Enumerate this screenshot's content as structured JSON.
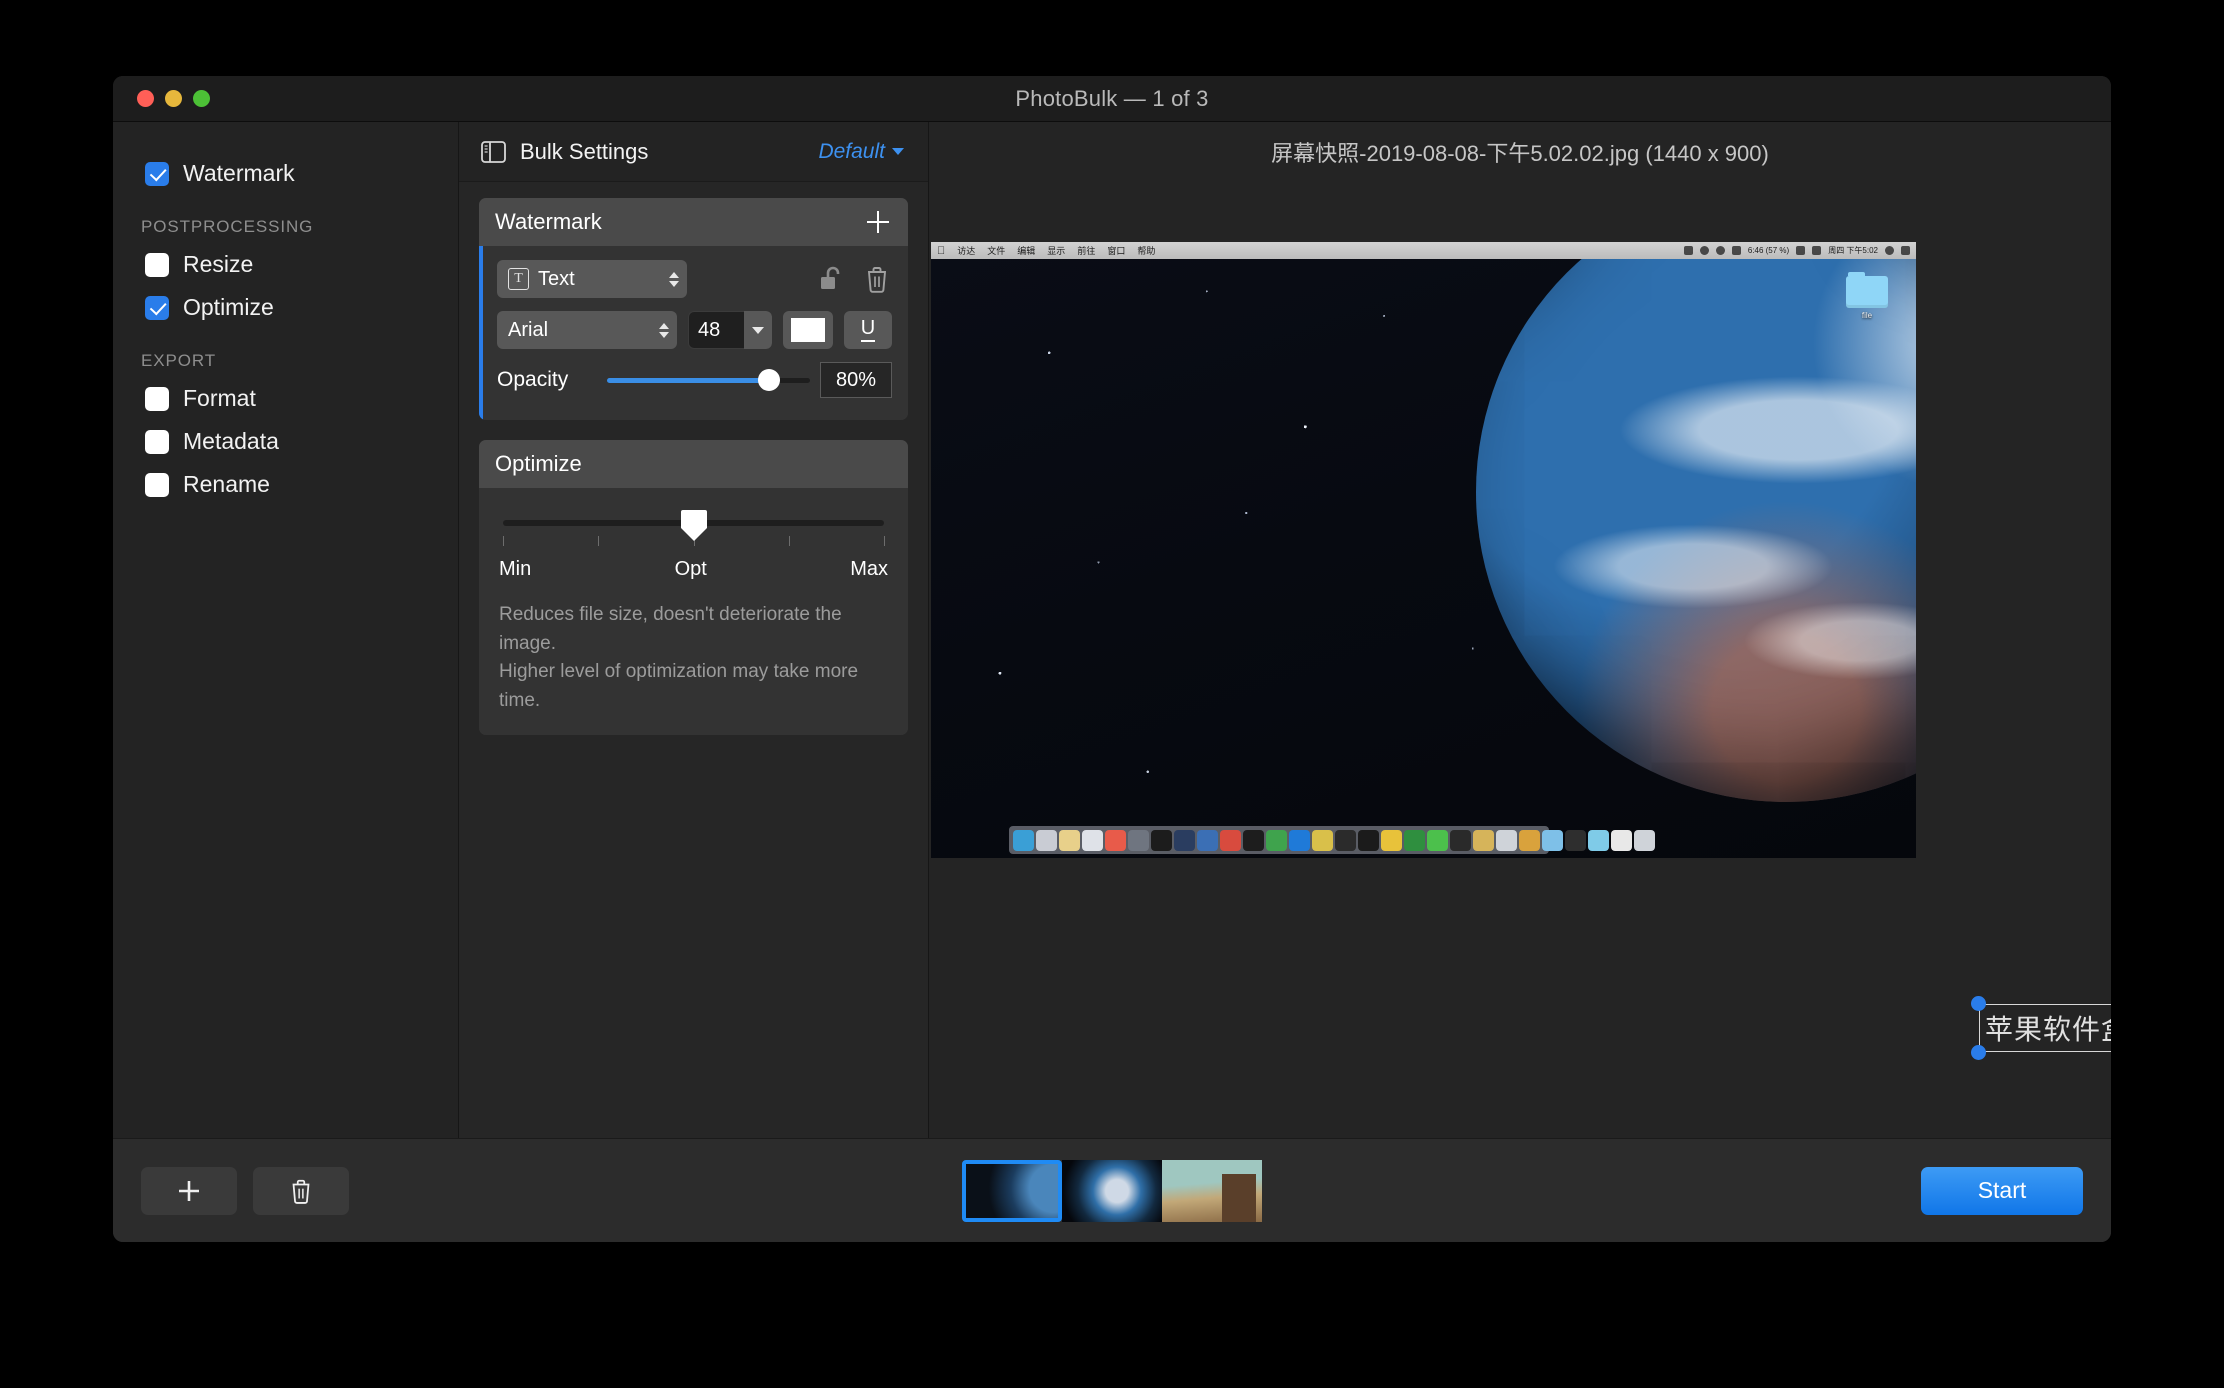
{
  "window": {
    "title": "PhotoBulk — 1 of 3",
    "traffic_lights": [
      "close",
      "minimize",
      "zoom"
    ]
  },
  "sidebar": {
    "top_items": [
      {
        "label": "Watermark",
        "checked": true
      }
    ],
    "groups": [
      {
        "header": "POSTPROCESSING",
        "items": [
          {
            "label": "Resize",
            "checked": false
          },
          {
            "label": "Optimize",
            "checked": true
          }
        ]
      },
      {
        "header": "EXPORT",
        "items": [
          {
            "label": "Format",
            "checked": false
          },
          {
            "label": "Metadata",
            "checked": false
          },
          {
            "label": "Rename",
            "checked": false
          }
        ]
      }
    ]
  },
  "settings": {
    "panel_icon": "sidebar-panel-icon",
    "title": "Bulk Settings",
    "preset": "Default",
    "watermark_card": {
      "header": "Watermark",
      "add_icon": "plus-icon",
      "type_select": {
        "value": "Text",
        "icon": "text-box-icon"
      },
      "lock_icon": "unlocked-padlock-icon",
      "delete_icon": "trash-icon",
      "font": "Arial",
      "size": "48",
      "color": "#ffffff",
      "underline_label": "U",
      "opacity_label": "Opacity",
      "opacity_value": "80%",
      "opacity_percent": 80
    },
    "optimize_card": {
      "header": "Optimize",
      "min_label": "Min",
      "opt_label": "Opt",
      "max_label": "Max",
      "level_percent": 50,
      "description_line1": "Reduces file size, doesn't deteriorate the image.",
      "description_line2": "Higher level of optimization may take more time."
    }
  },
  "preview": {
    "filename": "屏幕快照-2019-08-08-下午5.02.02.jpg (1440 x 900)",
    "watermark_text": "苹果软件盒子",
    "embedded_screenshot": {
      "menubar_left": [
        "访达",
        "文件",
        "编辑",
        "显示",
        "前往",
        "窗口",
        "帮助"
      ],
      "menubar_apple_icon": "apple-logo-icon",
      "menubar_battery": "6:46 (57 %)",
      "menubar_clock": "周四 下午5:02",
      "menubar_right_icons": [
        "wifi-icon",
        "volume-icon",
        "search-icon",
        "control-center-icon",
        "notification-icon"
      ],
      "desktop_folder_label": "file",
      "dock_colors": [
        "#3a9fd6",
        "#c9ccd4",
        "#e8d08a",
        "#dfe2e8",
        "#e85b4a",
        "#6f7580",
        "#1c1c1c",
        "#2a3d60",
        "#3b6fb5",
        "#d84b3e",
        "#1d1d1d",
        "#3fa34d",
        "#1f7ad8",
        "#d9c04a",
        "#2b2b2b",
        "#1b1b1b",
        "#e8c23a",
        "#2f8f3f",
        "#4cc04c",
        "#2a2a2a",
        "#d6b45a",
        "#cfd3d9",
        "#d9a23c",
        "#7ec0e8",
        "#2e2e2e",
        "#7fcbe8",
        "#e8e8e8",
        "#cfd3d9"
      ]
    }
  },
  "footer": {
    "add_icon": "plus-icon",
    "delete_icon": "trash-icon",
    "thumbnails": [
      {
        "selected": true
      },
      {
        "selected": false
      },
      {
        "selected": false
      }
    ],
    "start_label": "Start"
  },
  "colors": {
    "accent": "#2a7dea",
    "start_button": "#1076e8",
    "preset_link": "#3d91f0",
    "window_bg": "#2a2a2a"
  }
}
